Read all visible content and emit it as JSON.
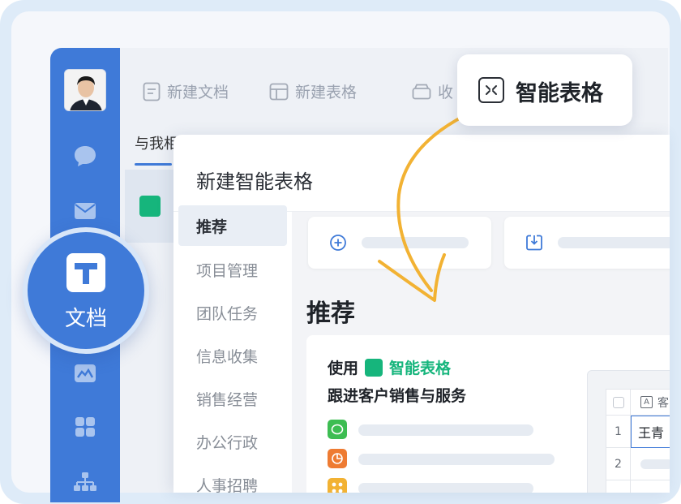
{
  "toolbar": {
    "new_doc": "新建文档",
    "new_sheet": "新建表格",
    "collect": "收"
  },
  "subtab": "与我相",
  "callout": {
    "label": "智能表格"
  },
  "badge": {
    "label": "文档"
  },
  "dialog": {
    "title": "新建智能表格",
    "categories": [
      "推荐",
      "项目管理",
      "团队任务",
      "信息收集",
      "销售经营",
      "办公行政",
      "人事招聘"
    ],
    "section_title": "推荐",
    "rec": {
      "prefix": "使用",
      "product": "智能表格",
      "line2": "跟进客户销售与服务"
    },
    "preview": {
      "col_letter": "A",
      "col_letter2": "客",
      "row1": "1",
      "row2": "2",
      "cell1": "王青"
    }
  },
  "colors": {
    "brand_blue": "#3f7ad8",
    "accent_green": "#16b57c",
    "arrow_orange": "#f2b233"
  }
}
